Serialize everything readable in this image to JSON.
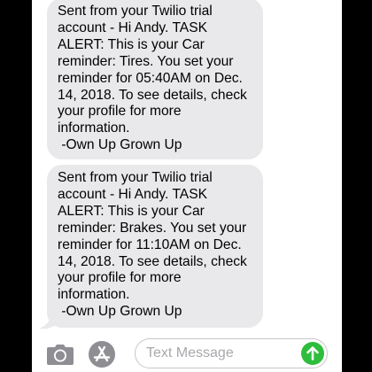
{
  "messages": [
    {
      "text": "Sent from your Twilio trial\naccount - Hi Andy. TASK\nALERT: This is your Car\nreminder: Tires. You set your\nreminder for 05:40AM on Dec.\n14, 2018. To see details, check\nyour profile for more\ninformation.\n -Own Up Grown Up",
      "direction": "incoming"
    },
    {
      "text": "Sent from your Twilio trial\naccount - Hi Andy. TASK\nALERT: This is your Car\nreminder: Brakes. You set your\nreminder for 11:10AM on Dec.\n14, 2018. To see details, check\nyour profile for more\ninformation.\n -Own Up Grown Up",
      "direction": "incoming"
    }
  ],
  "composer": {
    "placeholder": "Text Message",
    "value": "",
    "camera_icon": "camera-icon",
    "apps_icon": "app-store-icon",
    "send_icon": "send-arrow-icon"
  },
  "colors": {
    "bubble_incoming": "#e9e9eb",
    "send_button": "#2ebd3c",
    "icon_gray": "#8e8e93",
    "placeholder": "#a8a8ad",
    "background": "#000000"
  }
}
